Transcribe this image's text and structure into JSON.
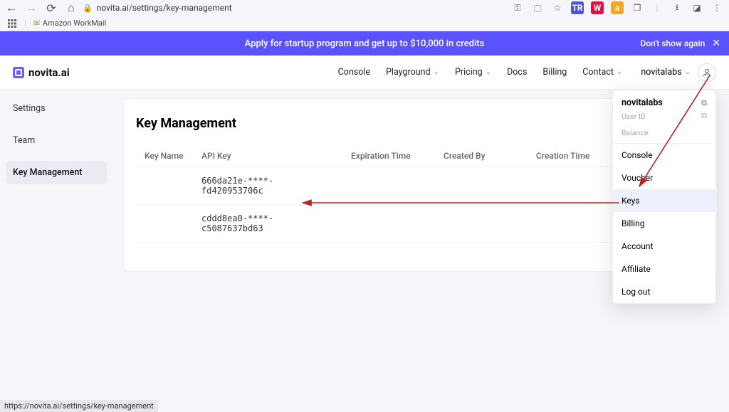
{
  "browser": {
    "url": "novita.ai/settings/key-management",
    "status_url": "https://novita.ai/settings/key-management",
    "bookmarks": {
      "amazon_workmail": "Amazon WorkMail"
    },
    "ext_badges": [
      "TR",
      "W",
      "a"
    ]
  },
  "banner": {
    "text": "Apply for startup program and get up to $10,000 in credits",
    "dismiss": "Don't show again"
  },
  "brand": "novita.ai",
  "nav": {
    "console": "Console",
    "playground": "Playground",
    "pricing": "Pricing",
    "docs": "Docs",
    "billing": "Billing",
    "contact": "Contact"
  },
  "team_name": "novitalabs",
  "sidebar": {
    "settings": "Settings",
    "team": "Team",
    "key_management": "Key Management"
  },
  "page": {
    "title": "Key Management",
    "columns": {
      "key_name": "Key Name",
      "api_key": "API Key",
      "expiration": "Expiration Time",
      "created_by": "Created By",
      "creation_time": "Creation Time"
    },
    "rows": [
      {
        "key_name": "",
        "api_key": "666da21e-****-fd420953706c",
        "expiration": "",
        "created_by": "",
        "creation_time": ""
      },
      {
        "key_name": "",
        "api_key": "cddd8ea0-****-c5087637bd63",
        "expiration": "",
        "created_by": "",
        "creation_time": ""
      }
    ]
  },
  "dropdown": {
    "username": "novitalabs",
    "user_id_label": "User ID",
    "balance_label": "Balance:",
    "items": {
      "console": "Console",
      "voucher": "Voucher",
      "keys": "Keys",
      "billing": "Billing",
      "account": "Account",
      "affiliate": "Affiliate",
      "logout": "Log out"
    }
  }
}
